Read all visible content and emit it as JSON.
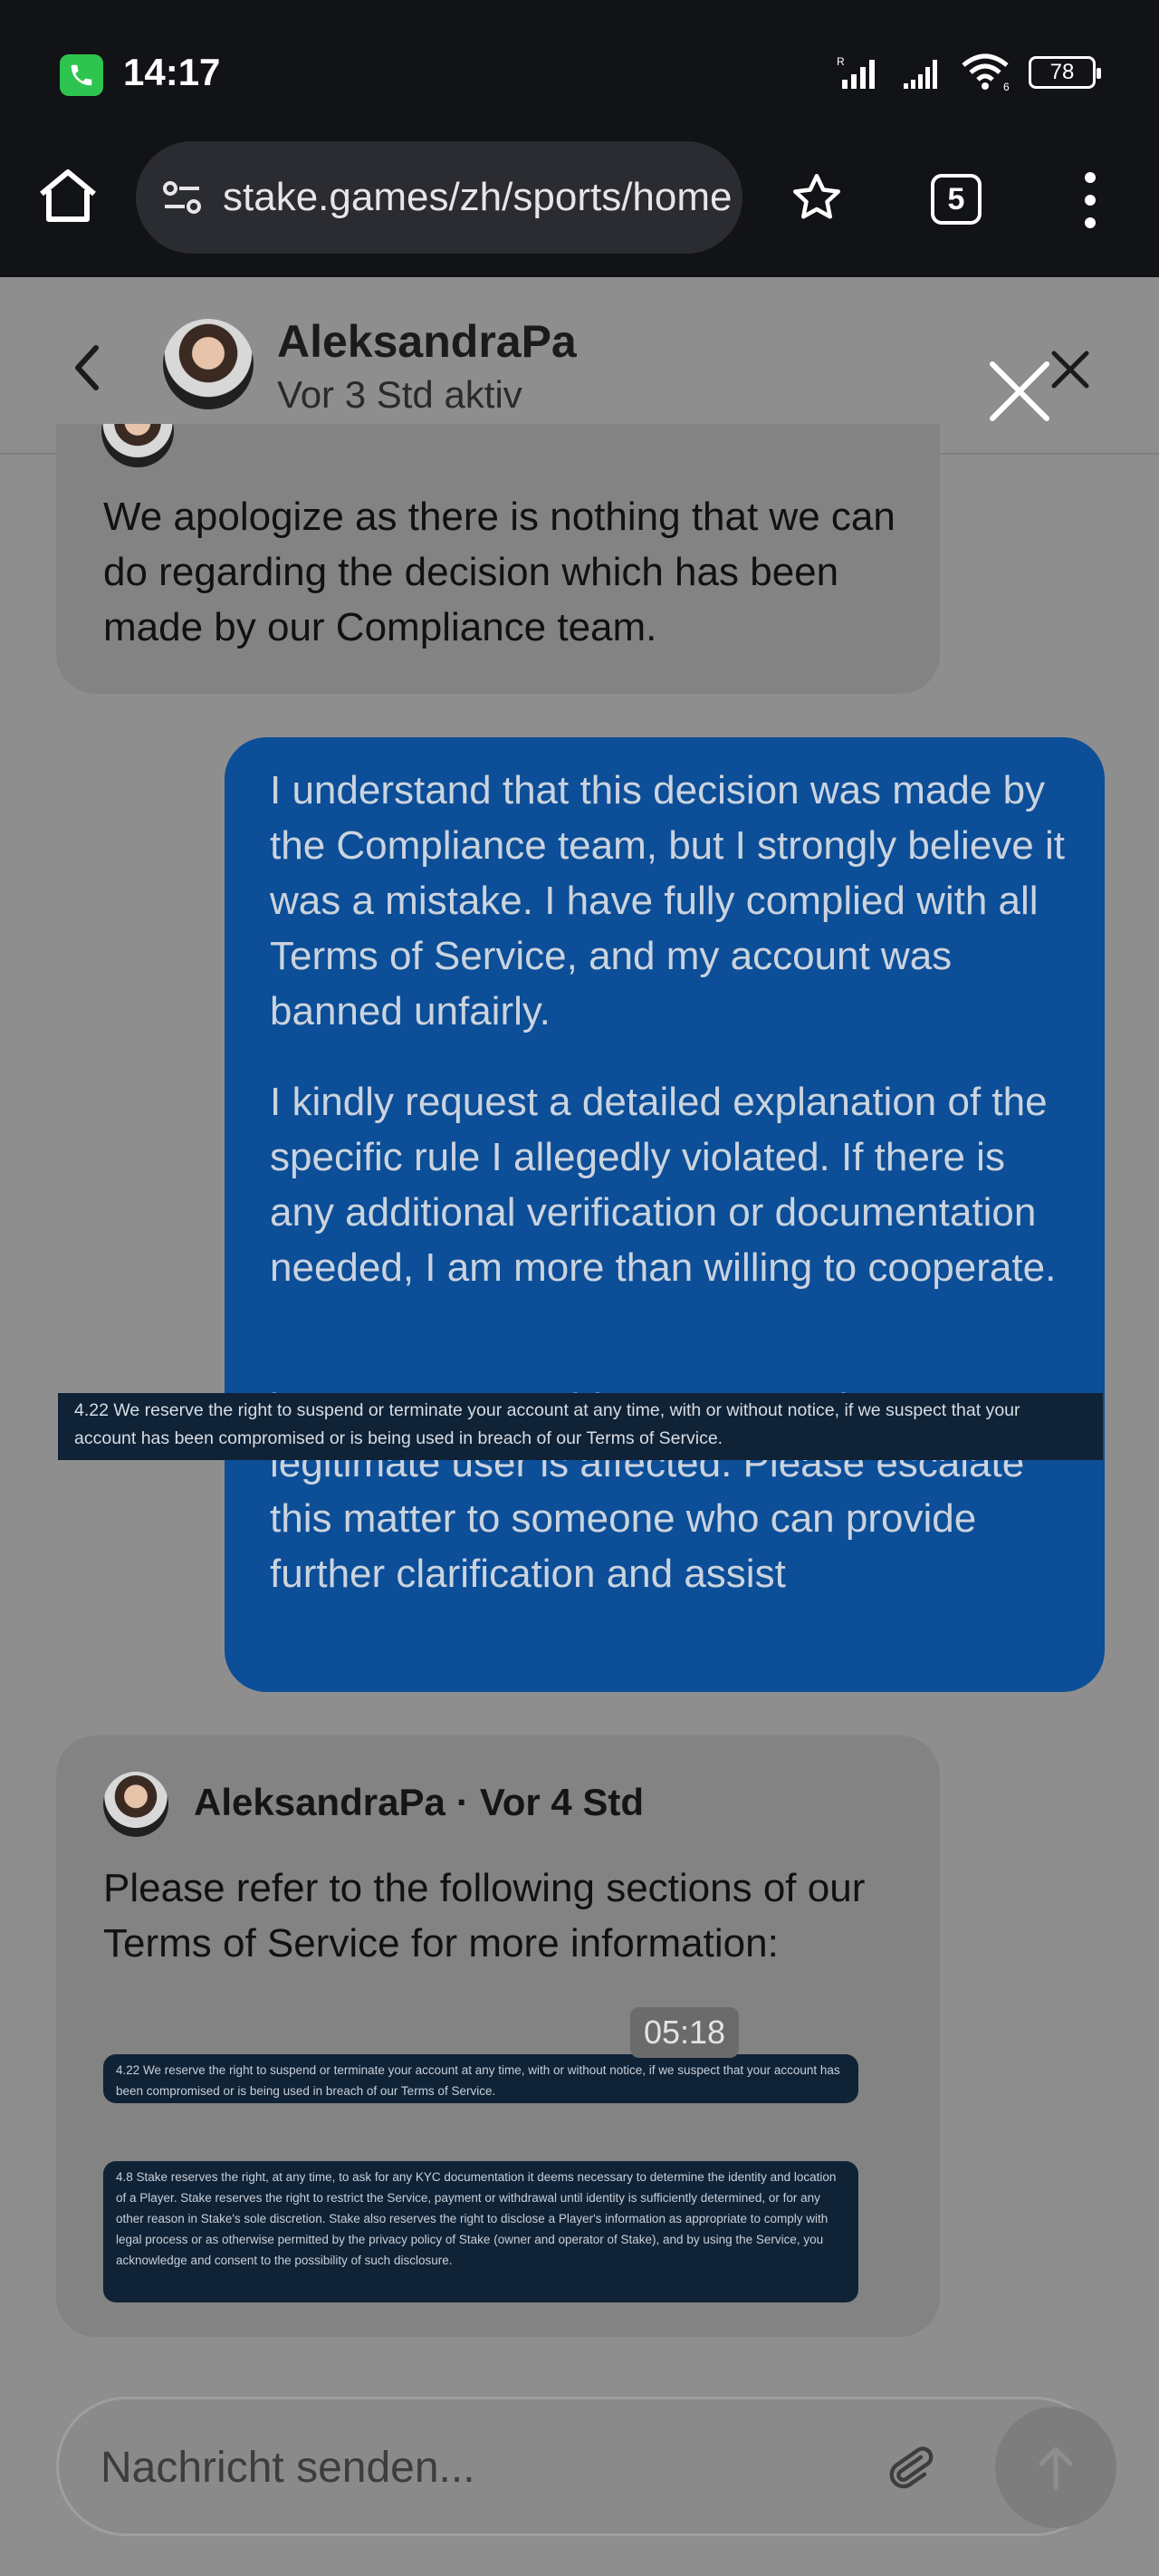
{
  "status_bar": {
    "time": "14:17",
    "battery": "78",
    "icons": [
      "call-active-icon",
      "signal-r-icon",
      "signal-icon",
      "wifi-6-icon",
      "battery-icon"
    ]
  },
  "browser": {
    "url": "stake.games/zh/sports/home",
    "tab_count": "5",
    "icons": [
      "home-icon",
      "site-settings-icon",
      "bookmark-star-icon",
      "tab-switcher-icon",
      "more-menu-icon"
    ]
  },
  "chat_header": {
    "agent_name": "AleksandraPa",
    "agent_status": "Vor 3 Std aktiv"
  },
  "messages": {
    "m1": {
      "text": "We apologize as there is nothing that we can do regarding the decision which has been made by our Compliance team."
    },
    "m2": {
      "p1": "I understand that this decision was made by the Compliance team, but I strongly believe it was a mistake. I have fully complied with all Terms of Service, and my account was banned unfairly.",
      "p2": "I kindly request a detailed explanation of the specific rule I allegedly violated. If there is any additional verification or documentation needed, I am more than willing to cooperate.",
      "p3": "is not an acceptable response when a legitimate user is affected. Please escalate this matter to someone who can provide further clarification and assist"
    },
    "overlay_tos": "4.22 We reserve the right to suspend or terminate your account at any time, with or without notice, if we suspect that your account has been compromised or is being used in breach of our Terms of Service.",
    "m3": {
      "author": "AleksandraPa",
      "separator": "·",
      "time": "Vor 4 Std",
      "text": "Please refer to the following sections of our Terms of Service for more information:",
      "tos_1": "4.22 We reserve the right to suspend or terminate your account at any time, with or without notice, if we suspect that your account has been compromised or is being used in breach of our Terms of Service.",
      "tos_2": "4.8 Stake reserves the right, at any time, to ask for any KYC documentation it deems necessary to determine the identity and location of a Player. Stake reserves the right to restrict the Service, payment or withdrawal until identity is sufficiently determined, or for any other reason in Stake's sole discretion. Stake also reserves the right to disclose a Player's information as appropriate to comply with legal process or as otherwise permitted by the privacy policy of Stake (owner and operator of Stake), and by using the Service, you acknowledge and consent to the possibility of such disclosure."
    },
    "timestamp": "05:18"
  },
  "composer": {
    "placeholder": "Nachricht senden..."
  },
  "colors": {
    "outgoing_bubble": "#0c4e97",
    "incoming_bubble": "#838383",
    "backdrop": "#8e8e8e"
  }
}
